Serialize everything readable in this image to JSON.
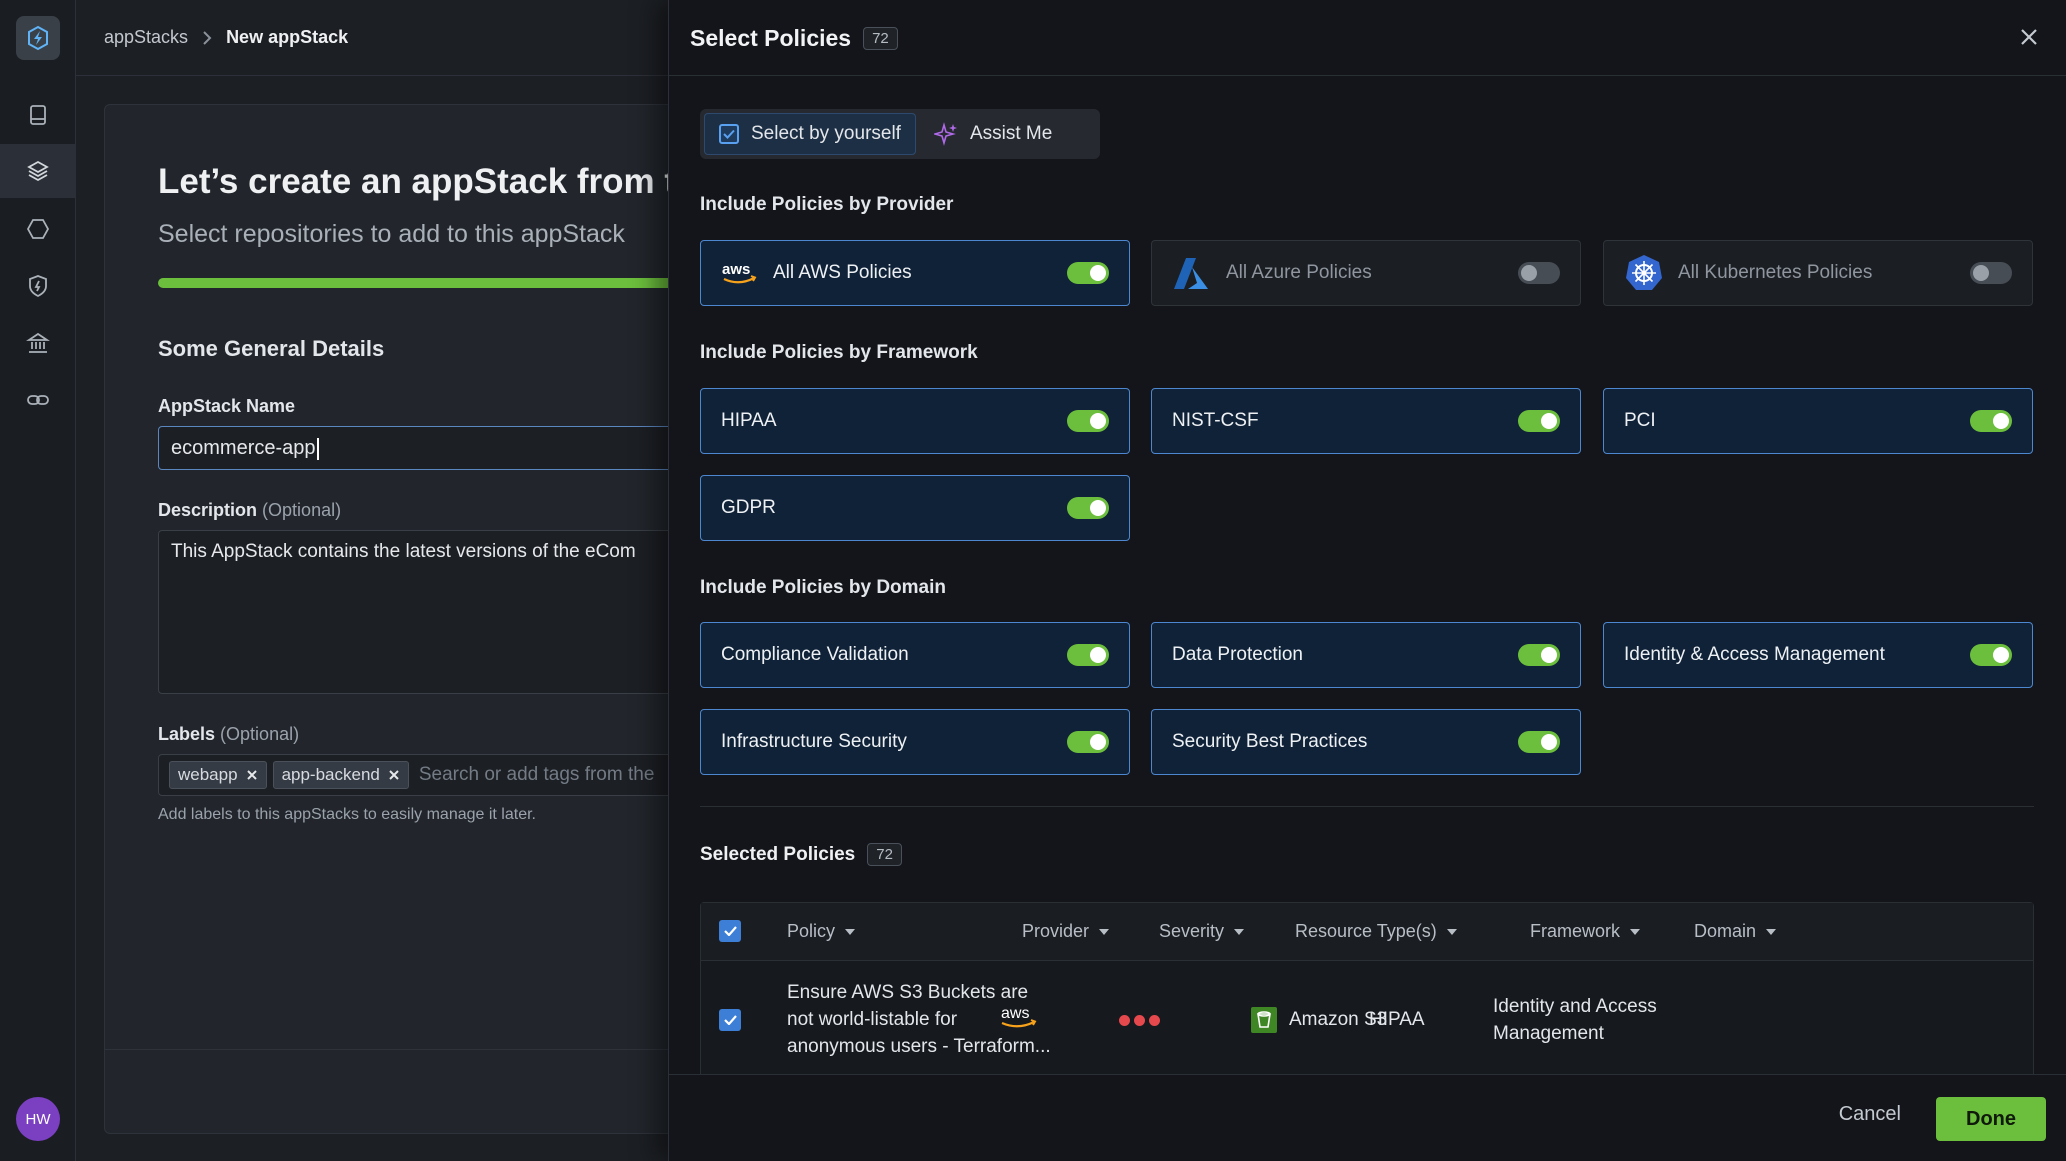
{
  "rail": {
    "avatar_initials": "HW"
  },
  "breadcrumb": {
    "parent": "appStacks",
    "current": "New appStack"
  },
  "page": {
    "title": "Let’s create an appStack from th",
    "subtitle": "Select repositories to add to this appStack",
    "section": "Some General Details",
    "name_label": "AppStack Name",
    "name_value": "ecommerce-app",
    "desc_label": "Description",
    "optional": "(Optional)",
    "desc_value": "This AppStack contains the latest versions of the eCom",
    "labels_label": "Labels",
    "tags": [
      "webapp",
      "app-backend"
    ],
    "tags_placeholder": "Search or add tags from the",
    "labels_hint": "Add labels to this appStacks to easily manage it later."
  },
  "panel": {
    "title": "Select Policies",
    "count": "72",
    "mode_self": "Select by yourself",
    "mode_assist": "Assist Me",
    "provider_heading": "Include Policies by Provider",
    "providers": [
      {
        "logo": "aws-logo",
        "label": "All AWS Policies",
        "on": true
      },
      {
        "logo": "azure-logo",
        "label": "All Azure Policies",
        "on": false
      },
      {
        "logo": "kubernetes-logo",
        "label": "All Kubernetes Policies",
        "on": false
      }
    ],
    "framework_heading": "Include Policies by Framework",
    "frameworks": [
      {
        "label": "HIPAA",
        "on": true
      },
      {
        "label": "NIST-CSF",
        "on": true
      },
      {
        "label": "PCI",
        "on": true
      },
      {
        "label": "GDPR",
        "on": true
      }
    ],
    "domain_heading": "Include Policies by Domain",
    "domains": [
      {
        "label": "Compliance Validation",
        "on": true
      },
      {
        "label": "Data Protection",
        "on": true
      },
      {
        "label": "Identity & Access Management",
        "on": true
      },
      {
        "label": "Infrastructure Security",
        "on": true
      },
      {
        "label": "Security Best Practices",
        "on": true
      }
    ],
    "selected_heading": "Selected Policies",
    "selected_count": "72",
    "columns": [
      "Policy",
      "Provider",
      "Severity",
      "Resource Type(s)",
      "Framework",
      "Domain"
    ],
    "rows": [
      {
        "policy_line1": "Ensure AWS S3 Buckets are",
        "policy_line2": "not world-listable for",
        "policy_line3": "anonymous users - Terraform...",
        "provider": "aws",
        "severity": "high",
        "resource": "Amazon S3",
        "framework": "HIPAA",
        "domain_line1": "Identity and Access",
        "domain_line2": "Management"
      }
    ],
    "cancel": "Cancel",
    "done": "Done"
  },
  "colors": {
    "accent_green": "#6cbf3d",
    "accent_blue": "#4d87cf",
    "severity_red": "#e5484d",
    "avatar": "#7b3fc2"
  }
}
